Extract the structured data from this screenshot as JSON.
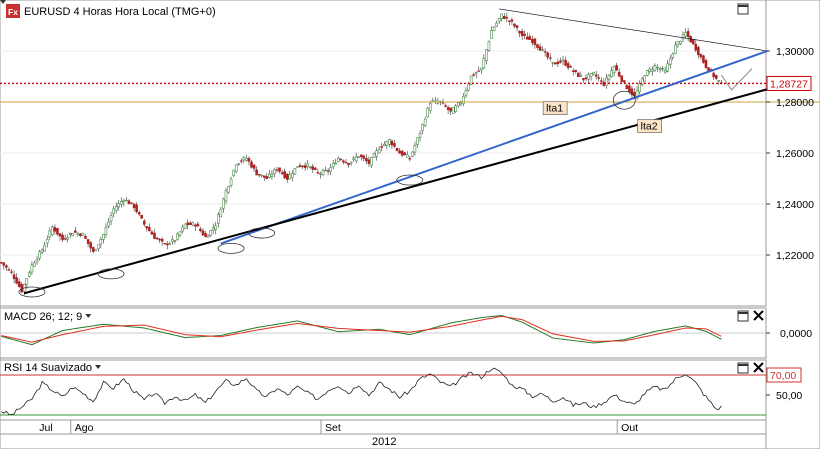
{
  "chart_data": {
    "type": "candlestick",
    "main": {
      "symbol_icon": "Fx",
      "title": "EURUSD 4 Horas Hora Local (TMG+0)",
      "ylim": [
        1.2,
        1.32
      ],
      "yticks": [
        {
          "value": 1.22,
          "label": "1,22000"
        },
        {
          "value": 1.24,
          "label": "1,24000"
        },
        {
          "value": 1.26,
          "label": "1,26000"
        },
        {
          "value": 1.28,
          "label": "1,28000"
        },
        {
          "value": 1.3,
          "label": "1,30000"
        }
      ],
      "last_price": {
        "value": 1.28727,
        "label": "1,28727"
      },
      "horizontal_level": 1.28,
      "up_color": "#2a7a2a",
      "down_color": "#b02020",
      "swing_points": [
        {
          "i": 0,
          "v": 1.217
        },
        {
          "i": 4,
          "v": 1.213
        },
        {
          "i": 8,
          "v": 1.206
        },
        {
          "i": 12,
          "v": 1.216
        },
        {
          "i": 16,
          "v": 1.222
        },
        {
          "i": 20,
          "v": 1.231
        },
        {
          "i": 24,
          "v": 1.226
        },
        {
          "i": 28,
          "v": 1.229
        },
        {
          "i": 32,
          "v": 1.228
        },
        {
          "i": 36,
          "v": 1.221
        },
        {
          "i": 40,
          "v": 1.228
        },
        {
          "i": 44,
          "v": 1.238
        },
        {
          "i": 48,
          "v": 1.242
        },
        {
          "i": 52,
          "v": 1.239
        },
        {
          "i": 56,
          "v": 1.232
        },
        {
          "i": 60,
          "v": 1.227
        },
        {
          "i": 64,
          "v": 1.224
        },
        {
          "i": 68,
          "v": 1.226
        },
        {
          "i": 72,
          "v": 1.232
        },
        {
          "i": 76,
          "v": 1.232
        },
        {
          "i": 80,
          "v": 1.227
        },
        {
          "i": 84,
          "v": 1.232
        },
        {
          "i": 88,
          "v": 1.245
        },
        {
          "i": 92,
          "v": 1.256
        },
        {
          "i": 96,
          "v": 1.258
        },
        {
          "i": 100,
          "v": 1.252
        },
        {
          "i": 104,
          "v": 1.25
        },
        {
          "i": 108,
          "v": 1.254
        },
        {
          "i": 112,
          "v": 1.25
        },
        {
          "i": 116,
          "v": 1.255
        },
        {
          "i": 120,
          "v": 1.255
        },
        {
          "i": 124,
          "v": 1.252
        },
        {
          "i": 128,
          "v": 1.253
        },
        {
          "i": 132,
          "v": 1.258
        },
        {
          "i": 136,
          "v": 1.256
        },
        {
          "i": 140,
          "v": 1.259
        },
        {
          "i": 144,
          "v": 1.256
        },
        {
          "i": 148,
          "v": 1.262
        },
        {
          "i": 152,
          "v": 1.265
        },
        {
          "i": 156,
          "v": 1.26
        },
        {
          "i": 160,
          "v": 1.258
        },
        {
          "i": 164,
          "v": 1.268
        },
        {
          "i": 168,
          "v": 1.28
        },
        {
          "i": 172,
          "v": 1.28
        },
        {
          "i": 176,
          "v": 1.276
        },
        {
          "i": 180,
          "v": 1.28
        },
        {
          "i": 184,
          "v": 1.29
        },
        {
          "i": 188,
          "v": 1.293
        },
        {
          "i": 192,
          "v": 1.308
        },
        {
          "i": 196,
          "v": 1.314
        },
        {
          "i": 200,
          "v": 1.311
        },
        {
          "i": 204,
          "v": 1.306
        },
        {
          "i": 208,
          "v": 1.304
        },
        {
          "i": 212,
          "v": 1.3
        },
        {
          "i": 216,
          "v": 1.295
        },
        {
          "i": 220,
          "v": 1.296
        },
        {
          "i": 224,
          "v": 1.292
        },
        {
          "i": 228,
          "v": 1.289
        },
        {
          "i": 232,
          "v": 1.291
        },
        {
          "i": 236,
          "v": 1.287
        },
        {
          "i": 240,
          "v": 1.294
        },
        {
          "i": 244,
          "v": 1.287
        },
        {
          "i": 248,
          "v": 1.282
        },
        {
          "i": 252,
          "v": 1.291
        },
        {
          "i": 256,
          "v": 1.294
        },
        {
          "i": 260,
          "v": 1.292
        },
        {
          "i": 264,
          "v": 1.302
        },
        {
          "i": 268,
          "v": 1.307
        },
        {
          "i": 272,
          "v": 1.301
        },
        {
          "i": 276,
          "v": 1.294
        },
        {
          "i": 280,
          "v": 1.289
        },
        {
          "i": 282,
          "v": 1.2873
        }
      ],
      "trendlines": [
        {
          "name": "upper",
          "color": "#000000",
          "width": 0.6,
          "from": {
            "i": 195,
            "v": 1.3165
          },
          "to": {
            "i": 300,
            "v": 1.3
          }
        },
        {
          "name": "blue",
          "color": "#3366cc",
          "width": 2,
          "from": {
            "i": 86,
            "v": 1.2245
          },
          "to": {
            "i": 300,
            "v": 1.3
          }
        },
        {
          "name": "black",
          "color": "#000000",
          "width": 2,
          "from": {
            "i": 9,
            "v": 1.205
          },
          "to": {
            "i": 300,
            "v": 1.285
          }
        }
      ],
      "projection": [
        {
          "i": 282,
          "v": 1.2906
        },
        {
          "i": 286,
          "v": 1.2847
        },
        {
          "i": 294,
          "v": 1.2931
        }
      ],
      "labels": [
        {
          "text": "lta1",
          "i": 213,
          "v": 1.2762
        },
        {
          "text": "lta2",
          "i": 250,
          "v": 1.2692
        }
      ],
      "ellipses": [
        {
          "i": 12,
          "v": 1.2055
        },
        {
          "i": 43,
          "v": 1.2126
        },
        {
          "i": 90,
          "v": 1.2226
        },
        {
          "i": 102,
          "v": 1.2286
        },
        {
          "i": 160,
          "v": 1.2494
        },
        {
          "i": 244,
          "v": 1.2807
        }
      ]
    },
    "macd": {
      "title": "MACD 26; 12; 9",
      "ylim": [
        -0.006,
        0.006
      ],
      "yticks": [
        {
          "value": 0,
          "label": "0,0000"
        }
      ],
      "macd_color": "#2a7a2a",
      "signal_color": "#e03020",
      "points": [
        {
          "i": 0,
          "m": -0.0008,
          "s": -0.0006
        },
        {
          "i": 12,
          "m": -0.0028,
          "s": -0.0022
        },
        {
          "i": 24,
          "m": 0.0006,
          "s": -0.0004
        },
        {
          "i": 40,
          "m": 0.0021,
          "s": 0.0016
        },
        {
          "i": 56,
          "m": 0.0012,
          "s": 0.0019
        },
        {
          "i": 72,
          "m": -0.0011,
          "s": -0.0004
        },
        {
          "i": 86,
          "m": -0.0006,
          "s": -0.0009
        },
        {
          "i": 100,
          "m": 0.0013,
          "s": 0.0007
        },
        {
          "i": 116,
          "m": 0.0029,
          "s": 0.0023
        },
        {
          "i": 132,
          "m": 0.0003,
          "s": 0.0011
        },
        {
          "i": 148,
          "m": 0.0009,
          "s": 0.0006
        },
        {
          "i": 160,
          "m": -0.0004,
          "s": 0.0002
        },
        {
          "i": 176,
          "m": 0.0024,
          "s": 0.0016
        },
        {
          "i": 188,
          "m": 0.0037,
          "s": 0.0031
        },
        {
          "i": 196,
          "m": 0.0042,
          "s": 0.004
        },
        {
          "i": 204,
          "m": 0.0026,
          "s": 0.0032
        },
        {
          "i": 216,
          "m": -0.0012,
          "s": -0.0002
        },
        {
          "i": 232,
          "m": -0.0024,
          "s": -0.002
        },
        {
          "i": 244,
          "m": -0.0016,
          "s": -0.0019
        },
        {
          "i": 256,
          "m": 0.0004,
          "s": -0.0004
        },
        {
          "i": 268,
          "m": 0.0017,
          "s": 0.0012
        },
        {
          "i": 276,
          "m": 0.0004,
          "s": 0.001
        },
        {
          "i": 282,
          "m": -0.0015,
          "s": -0.0008
        }
      ]
    },
    "rsi": {
      "title": "RSI 14 Suavizado",
      "ylim": [
        25,
        85
      ],
      "overbought": {
        "value": 70,
        "label": "70,00"
      },
      "oversold": 30,
      "yticks": [
        {
          "value": 50,
          "label": "50,00"
        }
      ],
      "points": [
        {
          "i": 0,
          "v": 34
        },
        {
          "i": 4,
          "v": 30
        },
        {
          "i": 8,
          "v": 38
        },
        {
          "i": 12,
          "v": 46
        },
        {
          "i": 16,
          "v": 62
        },
        {
          "i": 20,
          "v": 55
        },
        {
          "i": 24,
          "v": 48
        },
        {
          "i": 28,
          "v": 58
        },
        {
          "i": 32,
          "v": 52
        },
        {
          "i": 36,
          "v": 44
        },
        {
          "i": 40,
          "v": 62
        },
        {
          "i": 44,
          "v": 57
        },
        {
          "i": 48,
          "v": 66
        },
        {
          "i": 52,
          "v": 54
        },
        {
          "i": 56,
          "v": 45
        },
        {
          "i": 60,
          "v": 52
        },
        {
          "i": 64,
          "v": 42
        },
        {
          "i": 68,
          "v": 49
        },
        {
          "i": 72,
          "v": 44
        },
        {
          "i": 76,
          "v": 50
        },
        {
          "i": 80,
          "v": 42
        },
        {
          "i": 84,
          "v": 54
        },
        {
          "i": 88,
          "v": 64
        },
        {
          "i": 92,
          "v": 60
        },
        {
          "i": 96,
          "v": 67
        },
        {
          "i": 100,
          "v": 54
        },
        {
          "i": 104,
          "v": 48
        },
        {
          "i": 108,
          "v": 57
        },
        {
          "i": 112,
          "v": 50
        },
        {
          "i": 116,
          "v": 58
        },
        {
          "i": 120,
          "v": 52
        },
        {
          "i": 124,
          "v": 46
        },
        {
          "i": 128,
          "v": 55
        },
        {
          "i": 132,
          "v": 60
        },
        {
          "i": 136,
          "v": 52
        },
        {
          "i": 140,
          "v": 61
        },
        {
          "i": 144,
          "v": 50
        },
        {
          "i": 148,
          "v": 62
        },
        {
          "i": 152,
          "v": 56
        },
        {
          "i": 156,
          "v": 48
        },
        {
          "i": 160,
          "v": 54
        },
        {
          "i": 164,
          "v": 66
        },
        {
          "i": 168,
          "v": 71
        },
        {
          "i": 172,
          "v": 63
        },
        {
          "i": 176,
          "v": 58
        },
        {
          "i": 180,
          "v": 66
        },
        {
          "i": 184,
          "v": 72
        },
        {
          "i": 188,
          "v": 68
        },
        {
          "i": 192,
          "v": 77
        },
        {
          "i": 196,
          "v": 72
        },
        {
          "i": 200,
          "v": 60
        },
        {
          "i": 204,
          "v": 56
        },
        {
          "i": 208,
          "v": 49
        },
        {
          "i": 212,
          "v": 51
        },
        {
          "i": 216,
          "v": 44
        },
        {
          "i": 220,
          "v": 48
        },
        {
          "i": 224,
          "v": 40
        },
        {
          "i": 228,
          "v": 42
        },
        {
          "i": 232,
          "v": 38
        },
        {
          "i": 236,
          "v": 43
        },
        {
          "i": 240,
          "v": 50
        },
        {
          "i": 244,
          "v": 44
        },
        {
          "i": 248,
          "v": 40
        },
        {
          "i": 252,
          "v": 52
        },
        {
          "i": 256,
          "v": 58
        },
        {
          "i": 260,
          "v": 55
        },
        {
          "i": 264,
          "v": 66
        },
        {
          "i": 268,
          "v": 72
        },
        {
          "i": 272,
          "v": 62
        },
        {
          "i": 276,
          "v": 48
        },
        {
          "i": 280,
          "v": 36
        },
        {
          "i": 282,
          "v": 38
        }
      ]
    },
    "x_axis": {
      "bars": 300,
      "months": [
        {
          "label": "Jul",
          "i": 0,
          "tick": true
        },
        {
          "label": "Ago",
          "i": 28,
          "tick": true
        },
        {
          "label": "Set",
          "i": 126,
          "tick": true
        },
        {
          "label": "Out",
          "i": 242,
          "tick": true
        }
      ],
      "year": "2012"
    }
  }
}
